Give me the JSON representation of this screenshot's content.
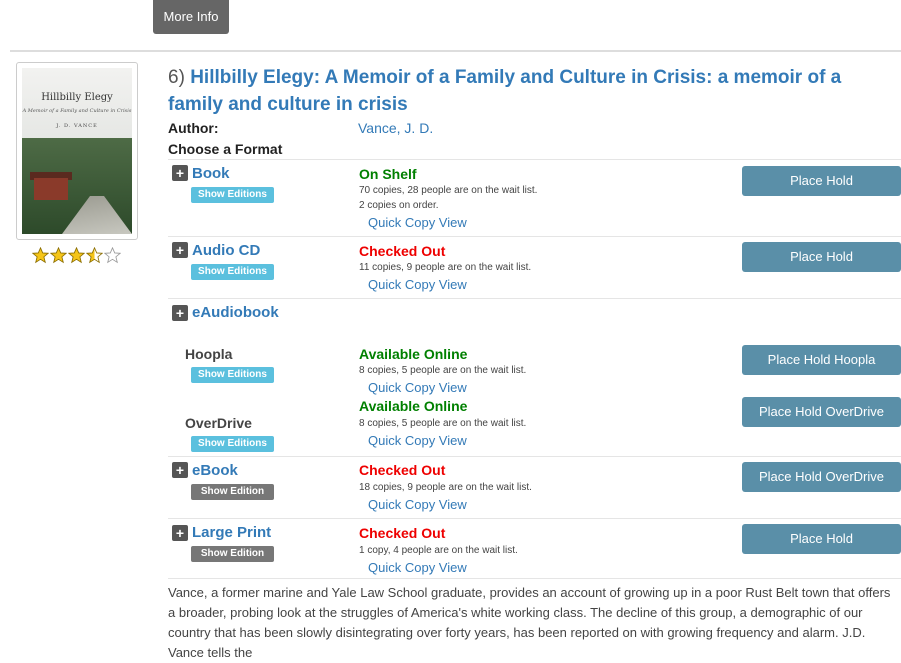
{
  "more_info_label": "More Info",
  "result": {
    "number": "6)",
    "title": "Hillbilly Elegy: A Memoir of a Family and Culture in Crisis: a memoir of a family and culture in crisis",
    "author_label": "Author:",
    "author": "Vance, J. D.",
    "choose_format_label": "Choose a Format",
    "rating": 3.5,
    "cover": {
      "title": "Hillbilly Elegy",
      "subtitle": "A Memoir of a Family and Culture in Crisis",
      "author": "J. D. VANCE"
    }
  },
  "formats": {
    "book": {
      "label": "Book",
      "editions": "Show Editions",
      "status": "On Shelf",
      "copies": "70 copies, 28 people are on the wait list.",
      "order": "2 copies on order.",
      "qcv": "Quick Copy View",
      "hold": "Place Hold"
    },
    "audiocd": {
      "label": "Audio CD",
      "editions": "Show Editions",
      "status": "Checked Out",
      "copies": "11 copies, 9 people are on the wait list.",
      "qcv": "Quick Copy View",
      "hold": "Place Hold"
    },
    "eaudio": {
      "label": "eAudiobook"
    },
    "hoopla": {
      "label": "Hoopla",
      "editions": "Show Editions",
      "status": "Available Online",
      "copies": "8 copies, 5 people are on the wait list.",
      "qcv": "Quick Copy View",
      "hold": "Place Hold Hoopla"
    },
    "overdrive": {
      "label": "OverDrive",
      "editions": "Show Editions",
      "status": "Available Online",
      "copies": "8 copies, 5 people are on the wait list.",
      "qcv": "Quick Copy View",
      "hold": "Place Hold OverDrive"
    },
    "ebook": {
      "label": "eBook",
      "editions": "Show Edition",
      "status": "Checked Out",
      "copies": "18 copies, 9 people are on the wait list.",
      "qcv": "Quick Copy View",
      "hold": "Place Hold OverDrive"
    },
    "largeprint": {
      "label": "Large Print",
      "editions": "Show Edition",
      "status": "Checked Out",
      "copies": "1 copy, 4 people are on the wait list.",
      "qcv": "Quick Copy View",
      "hold": "Place Hold"
    }
  },
  "description": "Vance, a former marine and Yale Law School graduate, provides an account of growing up in a poor Rust Belt town that offers a broader, probing look at the struggles of America's white working class. The decline of this group, a demographic of our country that has been slowly disintegrating over forty years, has been reported on with growing frequency and alarm. J.D. Vance tells the",
  "colors": {
    "link": "#337ab7",
    "green": "#008000",
    "red": "#e00000",
    "hold_button": "#5a8fa8",
    "editions_blue": "#5bc0de",
    "editions_gray": "#777777"
  }
}
